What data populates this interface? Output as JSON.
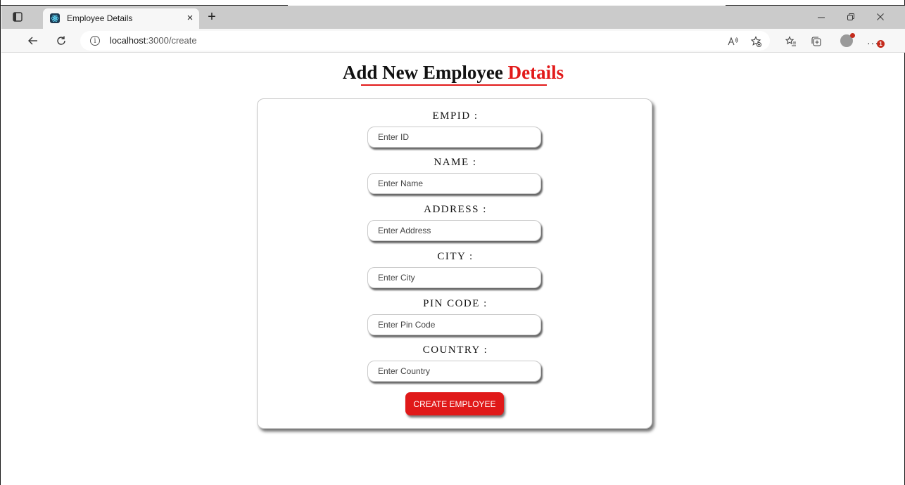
{
  "browser": {
    "tab_title": "Employee Details",
    "tab_close": "×",
    "new_tab": "+",
    "url_host": "localhost",
    "url_path": ":3000/create",
    "notification_count": "1"
  },
  "page": {
    "title_main": "Add New Employee ",
    "title_accent": "Details",
    "accent_color": "#e21a1a"
  },
  "form": {
    "fields": [
      {
        "label": "EMPID :",
        "placeholder": "Enter ID",
        "value": ""
      },
      {
        "label": "NAME :",
        "placeholder": "Enter Name",
        "value": ""
      },
      {
        "label": "ADDRESS :",
        "placeholder": "Enter Address",
        "value": ""
      },
      {
        "label": "CITY :",
        "placeholder": "Enter City",
        "value": ""
      },
      {
        "label": "PIN CODE :",
        "placeholder": "Enter Pin Code",
        "value": ""
      },
      {
        "label": "COUNTRY :",
        "placeholder": "Enter Country",
        "value": ""
      }
    ],
    "submit_label": "CREATE EMPLOYEE"
  }
}
